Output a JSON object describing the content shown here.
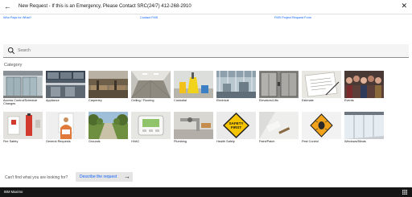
{
  "header": {
    "back_icon": "arrow-left-icon",
    "title": "New Request - If this is an Emergency, Please Contact SRC(24/7) 412-268-2910",
    "close_icon": "close-icon"
  },
  "links": [
    {
      "label": "Who Pays for What?"
    },
    {
      "label": "Contact FMS"
    },
    {
      "label": "FMS Project Request Form"
    }
  ],
  "search": {
    "placeholder": "Search",
    "value": ""
  },
  "category_heading": "Category",
  "categories": [
    {
      "label": "Access Control/Schedule Changes"
    },
    {
      "label": "Appliance"
    },
    {
      "label": "Carpentry"
    },
    {
      "label": "Ceiling / Flooring"
    },
    {
      "label": "Custodial"
    },
    {
      "label": "Electrical"
    },
    {
      "label": "Elevators/Lifts"
    },
    {
      "label": "Estimate"
    },
    {
      "label": "Events"
    },
    {
      "label": "Fire Safety"
    },
    {
      "label": "General Requests"
    },
    {
      "label": "Grounds"
    },
    {
      "label": "HVAC"
    },
    {
      "label": "Plumbing"
    },
    {
      "label": "Health Safety"
    },
    {
      "label": "Paint/Patch"
    },
    {
      "label": "Pest Control"
    },
    {
      "label": "Windows/Blinds"
    }
  ],
  "footer": {
    "question": "Can't find what you are looking for?",
    "describe_label": "Describe the request"
  },
  "bottom_bar": {
    "brand": "IBM Maximo"
  },
  "colors": {
    "link": "#0f62fe",
    "bottom_bar": "#161616",
    "search_bg": "#f4f4f4"
  }
}
